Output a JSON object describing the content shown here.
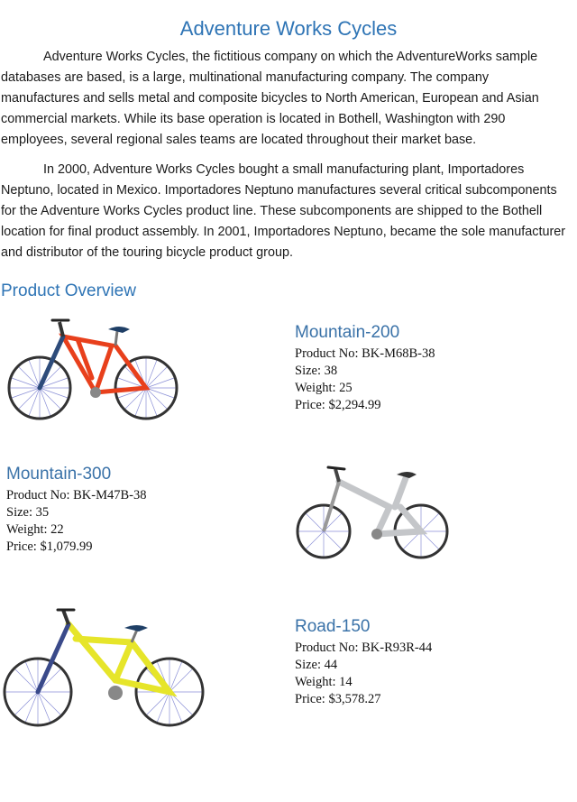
{
  "document": {
    "title": "Adventure Works Cycles",
    "paragraphs": [
      "Adventure Works Cycles, the fictitious company on which the AdventureWorks sample databases are based, is a large, multinational manufacturing company. The company manufactures and sells metal and composite bicycles to North American, European and Asian commercial markets. While its base operation is located in Bothell, Washington with 290 employees, several regional sales teams are located throughout their market base.",
      "In 2000, Adventure Works Cycles bought a small manufacturing plant, Importadores Neptuno, located in Mexico. Importadores Neptuno manufactures several critical subcomponents for the Adventure Works Cycles product line. These subcomponents are shipped to the Bothell location for final product assembly. In 2001, Importadores Neptuno, became the sole manufacturer and distributor of the touring bicycle product group."
    ],
    "section_heading": "Product Overview"
  },
  "products": [
    {
      "name": "Mountain-200",
      "product_no": "Product No: BK-M68B-38",
      "size": "Size: 38",
      "weight": "Weight: 25",
      "price": "Price: $2,294.99",
      "image_icon": "red-mountain-bike-image",
      "frame_color": "#e8401c"
    },
    {
      "name": "Mountain-300",
      "product_no": "Product No: BK-M47B-38",
      "size": "Size: 35",
      "weight": "Weight: 22",
      "price": "Price: $1,079.99",
      "image_icon": "silver-mountain-bike-image",
      "frame_color": "#c9cbcd"
    },
    {
      "name": "Road-150",
      "product_no": "Product No: BK-R93R-44",
      "size": "Size: 44",
      "weight": "Weight: 14",
      "price": "Price: $3,578.27",
      "image_icon": "yellow-bike-image",
      "frame_color": "#e6e52a"
    }
  ],
  "colors": {
    "heading": "#2e74b5",
    "product_name": "#3a72a8",
    "spokes": "#8a8fd6"
  }
}
